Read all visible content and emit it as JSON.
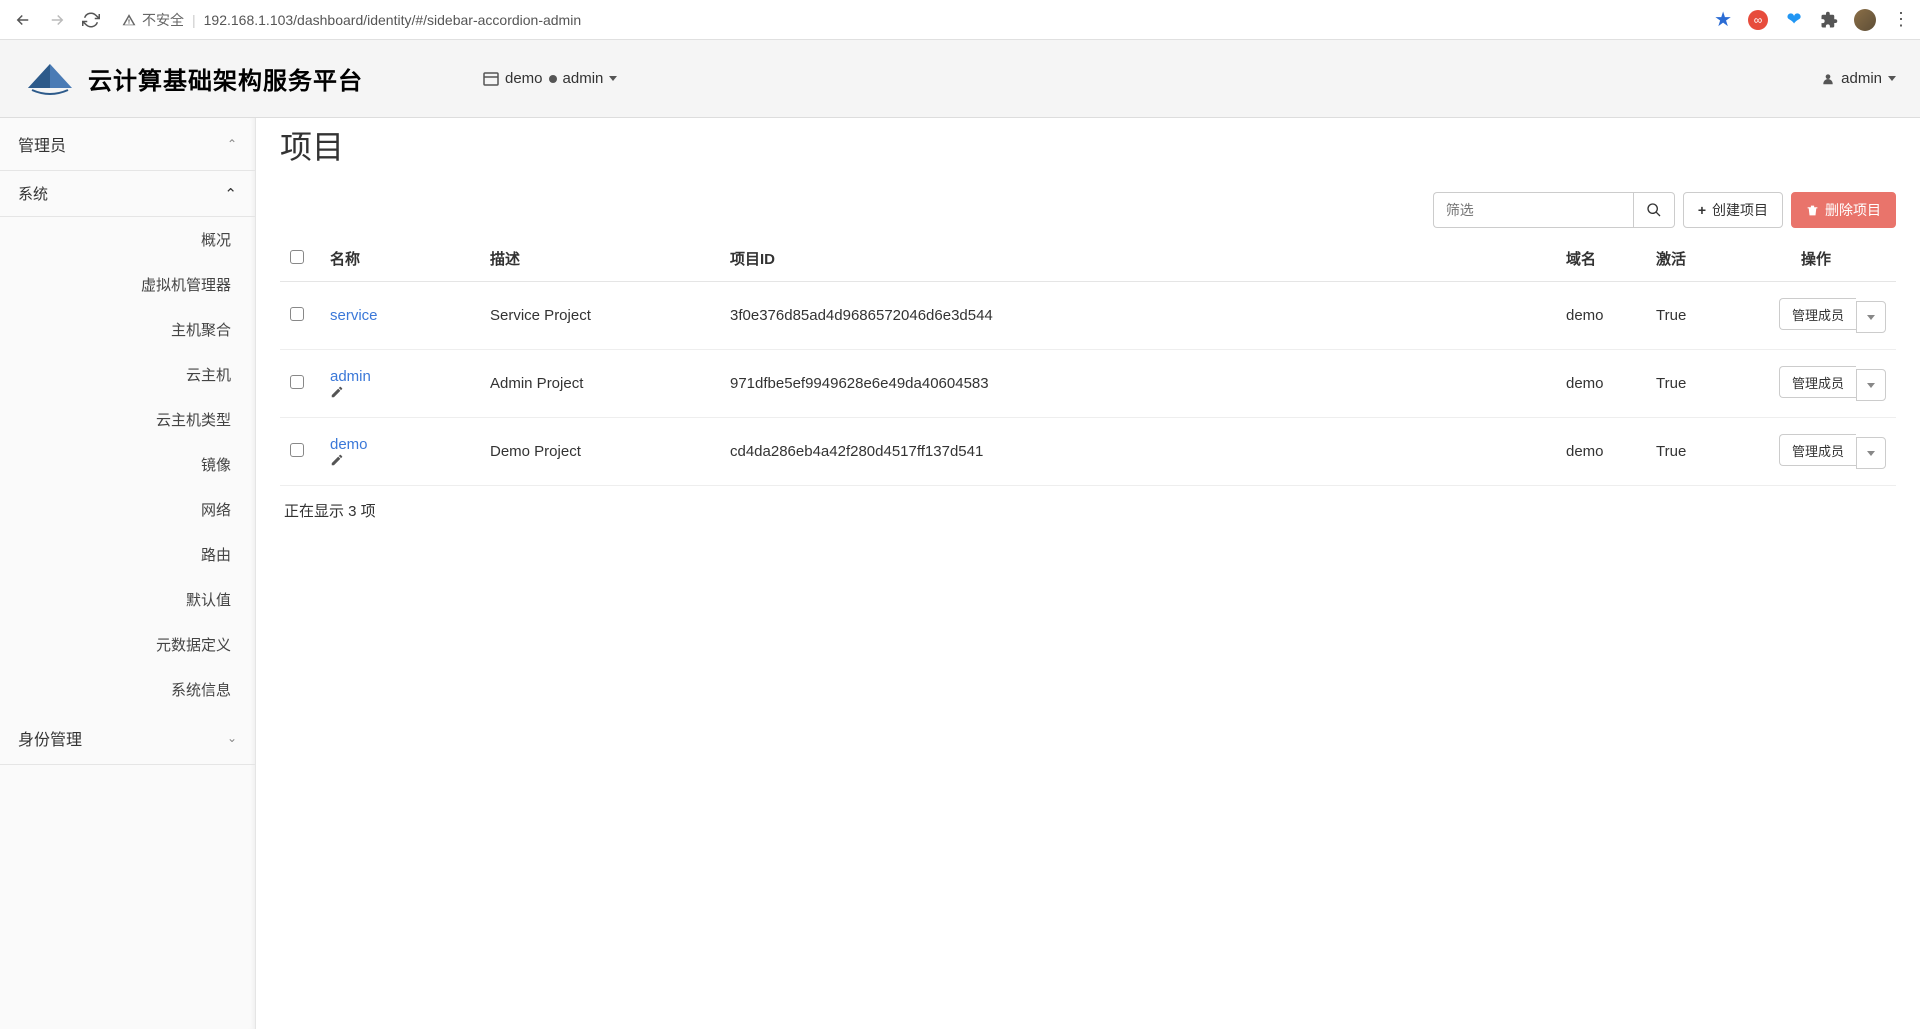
{
  "browser": {
    "insecure_label": "不安全",
    "url": "192.168.1.103/dashboard/identity/#/sidebar-accordion-admin"
  },
  "header": {
    "brand": "云计算基础架构服务平台",
    "context_project": "demo",
    "context_domain": "admin",
    "user": "admin"
  },
  "sidebar": {
    "admin_label": "管理员",
    "system_label": "系统",
    "identity_label": "身份管理",
    "items": [
      "概况",
      "虚拟机管理器",
      "主机聚合",
      "云主机",
      "云主机类型",
      "镜像",
      "网络",
      "路由",
      "默认值",
      "元数据定义",
      "系统信息"
    ]
  },
  "page": {
    "title": "项目",
    "filter_placeholder": "筛选",
    "create_label": "创建项目",
    "delete_label": "删除项目",
    "footer": "正在显示 3 项"
  },
  "table": {
    "headers": {
      "name": "名称",
      "desc": "描述",
      "id": "项目ID",
      "domain": "域名",
      "active": "激活",
      "actions": "操作"
    },
    "action_label": "管理成员",
    "rows": [
      {
        "name": "service",
        "desc": "Service Project",
        "id": "3f0e376d85ad4d9686572046d6e3d544",
        "domain": "demo",
        "active": "True",
        "editable": false
      },
      {
        "name": "admin",
        "desc": "Admin Project",
        "id": "971dfbe5ef9949628e6e49da40604583",
        "domain": "demo",
        "active": "True",
        "editable": true
      },
      {
        "name": "demo",
        "desc": "Demo Project",
        "id": "cd4da286eb4a42f280d4517ff137d541",
        "domain": "demo",
        "active": "True",
        "editable": true
      }
    ]
  }
}
